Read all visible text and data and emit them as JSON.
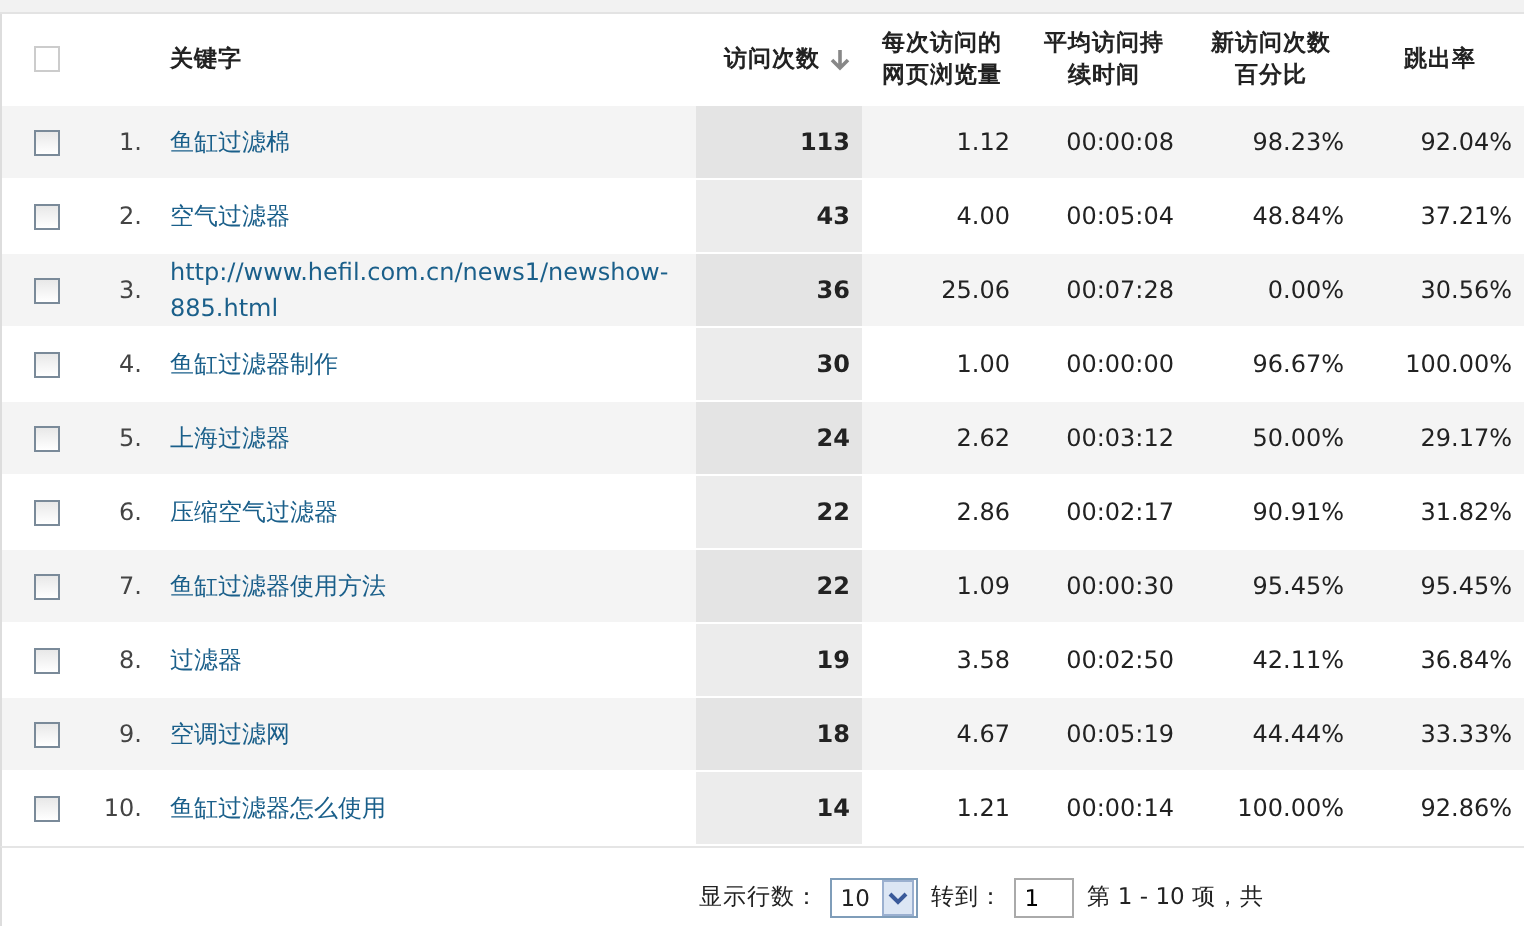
{
  "table": {
    "select_all": {
      "checked": false
    },
    "columns": [
      {
        "label": "关键字",
        "sorted": false
      },
      {
        "label": "访问次数",
        "sorted": true
      },
      {
        "label": "每次访问的网页浏览量",
        "sorted": false
      },
      {
        "label": "平均访问持续时间",
        "sorted": false
      },
      {
        "label": "新访问次数百分比",
        "sorted": false
      },
      {
        "label": "跳出率",
        "sorted": false
      }
    ],
    "rows": [
      {
        "checked": false,
        "index": "1.",
        "keyword": "鱼缸过滤棉",
        "visits": "113",
        "pages": "1.12",
        "duration": "00:00:08",
        "new_pct": "98.23%",
        "bounce": "92.04%"
      },
      {
        "checked": false,
        "index": "2.",
        "keyword": "空气过滤器",
        "visits": "43",
        "pages": "4.00",
        "duration": "00:05:04",
        "new_pct": "48.84%",
        "bounce": "37.21%"
      },
      {
        "checked": false,
        "index": "3.",
        "keyword": "http://www.hefil.com.cn/news1/newshow-885.html",
        "visits": "36",
        "pages": "25.06",
        "duration": "00:07:28",
        "new_pct": "0.00%",
        "bounce": "30.56%"
      },
      {
        "checked": false,
        "index": "4.",
        "keyword": "鱼缸过滤器制作",
        "visits": "30",
        "pages": "1.00",
        "duration": "00:00:00",
        "new_pct": "96.67%",
        "bounce": "100.00%"
      },
      {
        "checked": false,
        "index": "5.",
        "keyword": "上海过滤器",
        "visits": "24",
        "pages": "2.62",
        "duration": "00:03:12",
        "new_pct": "50.00%",
        "bounce": "29.17%"
      },
      {
        "checked": false,
        "index": "6.",
        "keyword": "压缩空气过滤器",
        "visits": "22",
        "pages": "2.86",
        "duration": "00:02:17",
        "new_pct": "90.91%",
        "bounce": "31.82%"
      },
      {
        "checked": false,
        "index": "7.",
        "keyword": "鱼缸过滤器使用方法",
        "visits": "22",
        "pages": "1.09",
        "duration": "00:00:30",
        "new_pct": "95.45%",
        "bounce": "95.45%"
      },
      {
        "checked": false,
        "index": "8.",
        "keyword": "过滤器",
        "visits": "19",
        "pages": "3.58",
        "duration": "00:02:50",
        "new_pct": "42.11%",
        "bounce": "36.84%"
      },
      {
        "checked": false,
        "index": "9.",
        "keyword": "空调过滤网",
        "visits": "18",
        "pages": "4.67",
        "duration": "00:05:19",
        "new_pct": "44.44%",
        "bounce": "33.33%"
      },
      {
        "checked": false,
        "index": "10.",
        "keyword": "鱼缸过滤器怎么使用",
        "visits": "14",
        "pages": "1.21",
        "duration": "00:00:14",
        "new_pct": "100.00%",
        "bounce": "92.86%"
      }
    ]
  },
  "pager": {
    "rows_label": "显示行数：",
    "rows_value": "10",
    "goto_label": "转到：",
    "goto_value": "1",
    "range_text": "第 1 - 10 项，共"
  }
}
